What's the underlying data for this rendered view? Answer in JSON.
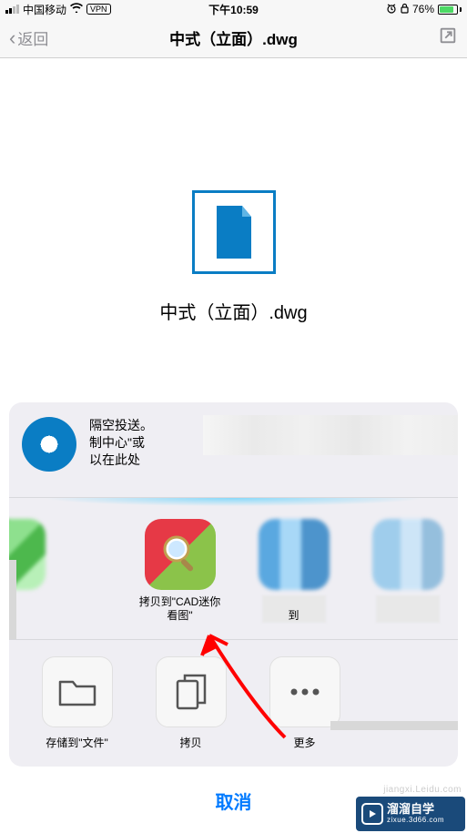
{
  "status": {
    "carrier": "中国移动",
    "vpn": "VPN",
    "time": "下午10:59",
    "battery_pct": "76%"
  },
  "nav": {
    "back": "返回",
    "title": "中式（立面）.dwg"
  },
  "file": {
    "name": "中式（立面）.dwg"
  },
  "airdrop": {
    "line1": "隔空投送。",
    "line2": "制中心\"或",
    "line3": "以在此处"
  },
  "apps": {
    "cad_label": "拷贝到\"CAD迷你看图\"",
    "partial": "到"
  },
  "actions": {
    "save_files": "存储到\"文件\"",
    "copy": "拷贝",
    "more": "更多"
  },
  "cancel": "取消",
  "watermark": {
    "title": "溜溜自学",
    "sub": "zixue.3d66.com"
  }
}
